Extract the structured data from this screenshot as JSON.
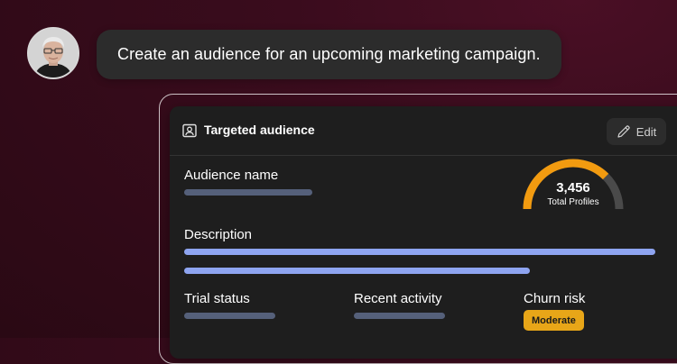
{
  "chat": {
    "message": "Create an audience for an upcoming marketing campaign."
  },
  "card": {
    "title": "Targeted audience",
    "title_icon": "user-card-icon",
    "edit_label": "Edit",
    "edit_icon": "pencil-icon"
  },
  "fields": {
    "audience_name_label": "Audience name",
    "description_label": "Description",
    "trial_status_label": "Trial status",
    "recent_activity_label": "Recent activity",
    "churn_risk_label": "Churn risk",
    "churn_risk_value": "Moderate"
  },
  "gauge": {
    "value": "3,456",
    "caption": "Total Profiles",
    "fill_fraction": 0.75,
    "fill_color": "#f29b10",
    "track_color": "#4a4a4a"
  },
  "colors": {
    "accent_blue": "#8ea4f0",
    "badge_yellow": "#e8a618"
  }
}
